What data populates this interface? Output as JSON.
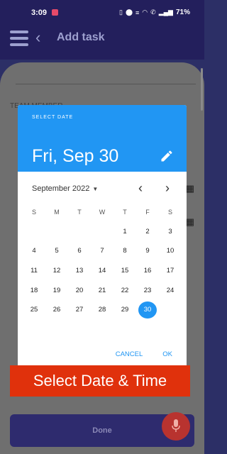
{
  "status_bar": {
    "time": "3:09",
    "icons": [
      "vibrate-icon",
      "location-icon",
      "data-speed-icon",
      "wifi-icon",
      "wifi-call-icon",
      "signal-icon"
    ],
    "battery": "71%"
  },
  "app_bar": {
    "title": "Add task"
  },
  "form": {
    "team_member_label": "TEAM MEMBER",
    "done_label": "Done"
  },
  "date_picker": {
    "header_label": "SELECT DATE",
    "header_date": "Fri, Sep 30",
    "month_label": "September 2022",
    "weekdays": [
      "S",
      "M",
      "T",
      "W",
      "T",
      "F",
      "S"
    ],
    "weeks": [
      [
        "",
        "",
        "",
        "",
        "1",
        "2",
        "3"
      ],
      [
        "4",
        "5",
        "6",
        "7",
        "8",
        "9",
        "10"
      ],
      [
        "11",
        "12",
        "13",
        "14",
        "15",
        "16",
        "17"
      ],
      [
        "18",
        "19",
        "20",
        "21",
        "22",
        "23",
        "24"
      ],
      [
        "25",
        "26",
        "27",
        "28",
        "29",
        "30",
        ""
      ]
    ],
    "selected_day": "30",
    "cancel_label": "CANCEL",
    "ok_label": "OK",
    "accent_color": "#2196f3"
  },
  "banner": {
    "text": "Select Date & Time"
  }
}
